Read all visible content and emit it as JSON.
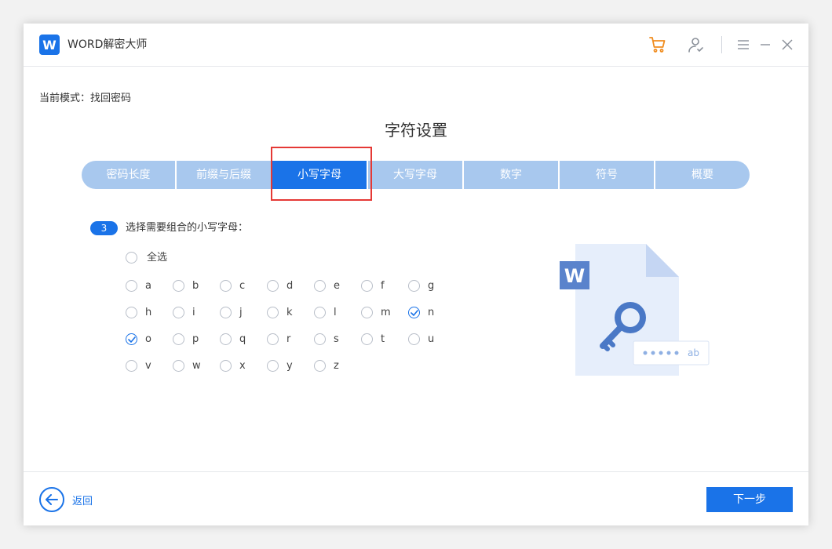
{
  "app": {
    "title": "WORD解密大师",
    "logo_letter": "W"
  },
  "colors": {
    "accent": "#1a73e8",
    "tab_inactive": "#a8c8ee",
    "cart": "#f08c1e",
    "highlight": "#e53935"
  },
  "titlebar": {
    "icons": [
      "cart-icon",
      "user-icon",
      "menu-icon",
      "minimize-icon",
      "close-icon"
    ]
  },
  "mode": {
    "label": "当前模式：找回密码"
  },
  "section": {
    "title": "字符设置"
  },
  "tabs": [
    {
      "label": "密码长度",
      "active": false
    },
    {
      "label": "前缀与后缀",
      "active": false
    },
    {
      "label": "小写字母",
      "active": true
    },
    {
      "label": "大写字母",
      "active": false
    },
    {
      "label": "数字",
      "active": false
    },
    {
      "label": "符号",
      "active": false
    },
    {
      "label": "概要",
      "active": false
    }
  ],
  "step": {
    "number": "3",
    "label": "选择需要组合的小写字母："
  },
  "select_all": {
    "label": "全选",
    "checked": false
  },
  "letters": [
    {
      "label": "a",
      "checked": false
    },
    {
      "label": "b",
      "checked": false
    },
    {
      "label": "c",
      "checked": false
    },
    {
      "label": "d",
      "checked": false
    },
    {
      "label": "e",
      "checked": false
    },
    {
      "label": "f",
      "checked": false
    },
    {
      "label": "g",
      "checked": false
    },
    {
      "label": "h",
      "checked": false
    },
    {
      "label": "i",
      "checked": false
    },
    {
      "label": "j",
      "checked": false
    },
    {
      "label": "k",
      "checked": false
    },
    {
      "label": "l",
      "checked": false
    },
    {
      "label": "m",
      "checked": false
    },
    {
      "label": "n",
      "checked": true
    },
    {
      "label": "o",
      "checked": true
    },
    {
      "label": "p",
      "checked": false
    },
    {
      "label": "q",
      "checked": false
    },
    {
      "label": "r",
      "checked": false
    },
    {
      "label": "s",
      "checked": false
    },
    {
      "label": "t",
      "checked": false
    },
    {
      "label": "u",
      "checked": false
    },
    {
      "label": "v",
      "checked": false
    },
    {
      "label": "w",
      "checked": false
    },
    {
      "label": "x",
      "checked": false
    },
    {
      "label": "y",
      "checked": false
    },
    {
      "label": "z",
      "checked": false
    }
  ],
  "illustration": {
    "doc_letter": "W",
    "password_text": "ab"
  },
  "footer": {
    "back_label": "返回",
    "next_label": "下一步"
  }
}
